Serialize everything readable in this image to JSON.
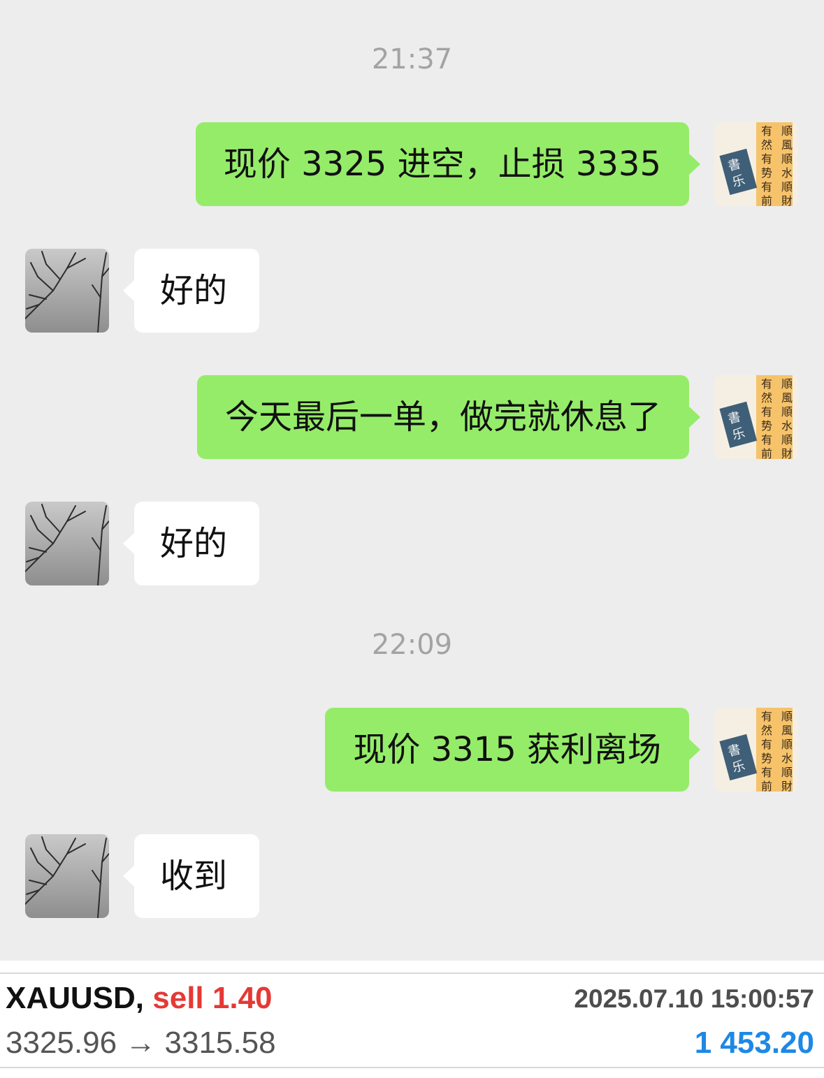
{
  "chat": {
    "items": [
      {
        "kind": "time",
        "text": "21:37"
      },
      {
        "kind": "msg",
        "from": "me",
        "text": "现价 3325 进空，止损 3335"
      },
      {
        "kind": "msg",
        "from": "them",
        "text": "好的"
      },
      {
        "kind": "msg",
        "from": "me",
        "text": "今天最后一单，做完就休息了"
      },
      {
        "kind": "msg",
        "from": "them",
        "text": "好的"
      },
      {
        "kind": "time",
        "text": "22:09"
      },
      {
        "kind": "msg",
        "from": "me",
        "text": "现价 3315 获利离场"
      },
      {
        "kind": "msg",
        "from": "them",
        "text": "收到"
      }
    ]
  },
  "avatars": {
    "me": {
      "icon": "calligraphy-avatar-icon",
      "chars_right": "顺風順水順財",
      "chars_left": "有然有势有前",
      "seal": "書乐"
    },
    "them": {
      "icon": "bare-tree-avatar-icon"
    }
  },
  "trade": {
    "symbol": "XAUUSD,",
    "side": "sell 1.40",
    "time": "2025.07.10 15:00:57",
    "prices": "3325.96 → 3315.58",
    "profit": "1 453.20"
  },
  "colors": {
    "chat_bg": "#ededed",
    "my_bubble": "#95ec69",
    "their_bubble": "#ffffff",
    "sell": "#e53935",
    "profit": "#1e88e5"
  }
}
